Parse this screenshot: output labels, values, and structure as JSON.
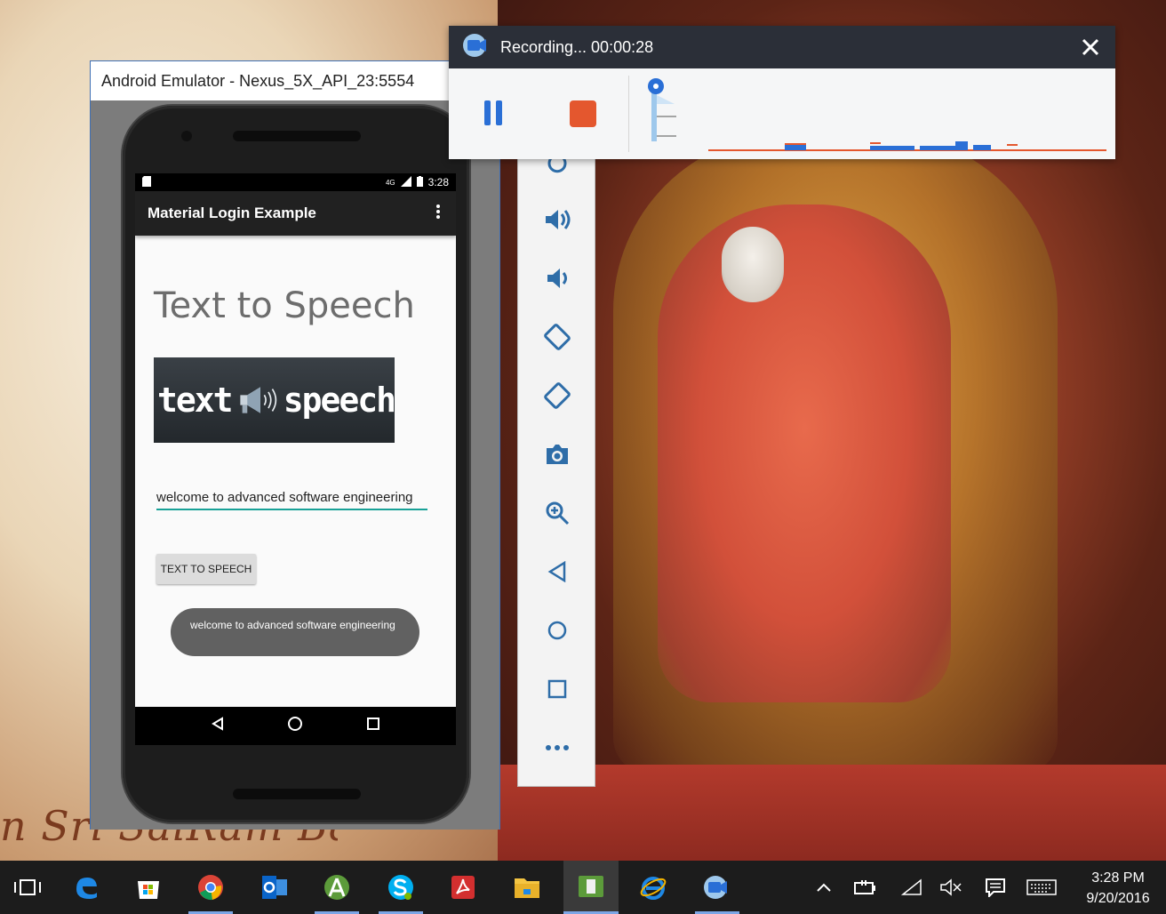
{
  "wallpaper": {
    "caption": "n Sri SaiRam Baba"
  },
  "emulator": {
    "window_title": "Android Emulator - Nexus_5X_API_23:5554",
    "status_bar": {
      "signal": "4G",
      "time": "3:28"
    },
    "app_bar": {
      "title": "Material Login Example",
      "menu_icon": "overflow-menu-icon"
    },
    "screen": {
      "heading": "Text to Speech",
      "banner": {
        "left_word": "text",
        "right_word": "speech"
      },
      "input_value": "welcome to advanced software engineering",
      "button_label": "TEXT TO SPEECH",
      "toast_text": "welcome to advanced software engineering"
    },
    "nav_bar": [
      "back-icon",
      "home-icon",
      "recents-icon"
    ]
  },
  "side_toolbar": {
    "tools": [
      "power-icon",
      "volume-up-icon",
      "volume-down-icon",
      "rotate-left-icon",
      "rotate-right-icon",
      "camera-icon",
      "zoom-icon",
      "back-icon",
      "home-icon",
      "overview-icon",
      "more-icon"
    ]
  },
  "recorder": {
    "status": "Recording... 00:00:28",
    "colors": {
      "stop": "#e4572e",
      "pause": "#2a6fd6",
      "titlebar": "#2b2f38"
    }
  },
  "taskbar": {
    "apps": [
      "task-view-icon",
      "edge-icon",
      "store-icon",
      "chrome-icon",
      "outlook-icon",
      "android-studio-icon",
      "skype-icon",
      "acrobat-icon",
      "file-explorer-icon",
      "emulator-icon",
      "internet-explorer-icon",
      "recorder-icon"
    ],
    "tray": [
      "chevron-up-icon",
      "battery-icon",
      "wifi-icon",
      "mute-icon",
      "notifications-icon",
      "keyboard-icon"
    ],
    "clock": {
      "time": "3:28 PM",
      "date": "9/20/2016"
    }
  }
}
